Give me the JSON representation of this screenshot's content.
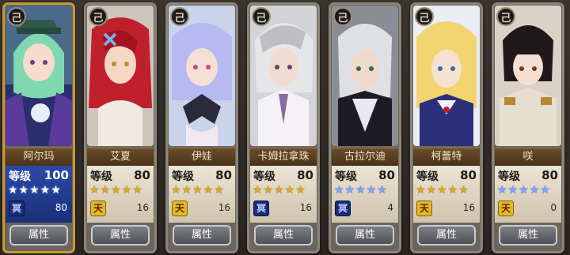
{
  "labels": {
    "level": "等级",
    "button": "属性",
    "badge": "己"
  },
  "cards": [
    {
      "name": "阿尔玛",
      "level": "100",
      "stars": "★★★★★",
      "rank": "冥",
      "count": "80"
    },
    {
      "name": "艾夏",
      "level": "80",
      "stars": "★★★★★",
      "rank": "天",
      "count": "16"
    },
    {
      "name": "伊娃",
      "level": "80",
      "stars": "★★★★★",
      "rank": "天",
      "count": "16"
    },
    {
      "name": "卡姆拉拿珠",
      "level": "80",
      "stars": "★★★★★",
      "rank": "冥",
      "count": "16"
    },
    {
      "name": "古拉尔迪",
      "level": "80",
      "stars": "★★★★★",
      "rank": "冥",
      "count": "4"
    },
    {
      "name": "柯蕾特",
      "level": "80",
      "stars": "★★★★★",
      "rank": "天",
      "count": "16"
    },
    {
      "name": "咲",
      "level": "80",
      "stars": "★★★★★",
      "rank": "天",
      "count": "0"
    }
  ],
  "colors": {
    "gold_star": "#d8a72c",
    "blue_star": "#7ea3ff",
    "rank_yellow": "#e2b92a",
    "rank_blue": "#1b2a7a",
    "selected_panel": "#2b4aa8"
  }
}
